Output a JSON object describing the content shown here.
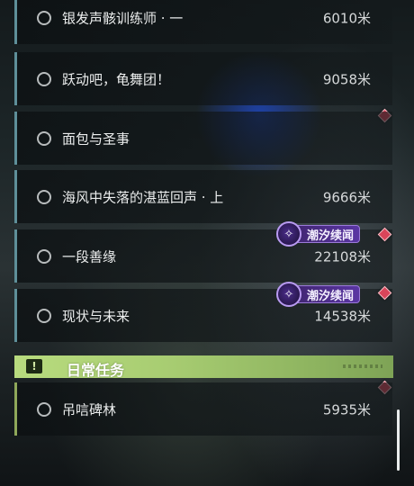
{
  "quests": [
    {
      "title": "银发声骸训练师 · 一",
      "distance": "6010米",
      "marker": false,
      "tag": false
    },
    {
      "title": "跃动吧，龟舞团！",
      "distance": "9058米",
      "marker": false,
      "tag": false
    },
    {
      "title": "面包与圣事",
      "distance": "",
      "marker": true,
      "tag": false
    },
    {
      "title": "海风中失落的湛蓝回声 · 上",
      "distance": "9666米",
      "marker": false,
      "tag": false
    },
    {
      "title": "一段善缘",
      "distance": "22108米",
      "marker": true,
      "tag": true
    },
    {
      "title": "现状与未来",
      "distance": "14538米",
      "marker": true,
      "tag": true
    }
  ],
  "tag_label": "潮汐续闻",
  "daily_section": {
    "title": "日常任务",
    "icon": "exclamation-icon",
    "quests": [
      {
        "title": "吊唁碑林",
        "distance": "5935米",
        "marker": true
      }
    ]
  },
  "colors": {
    "accent_bar": "#5e8f99",
    "daily_accent": "#8fa85a",
    "marker_red": "#d9455a",
    "tag_purple": "#5a36a3",
    "header_green": "#b8db7e"
  }
}
